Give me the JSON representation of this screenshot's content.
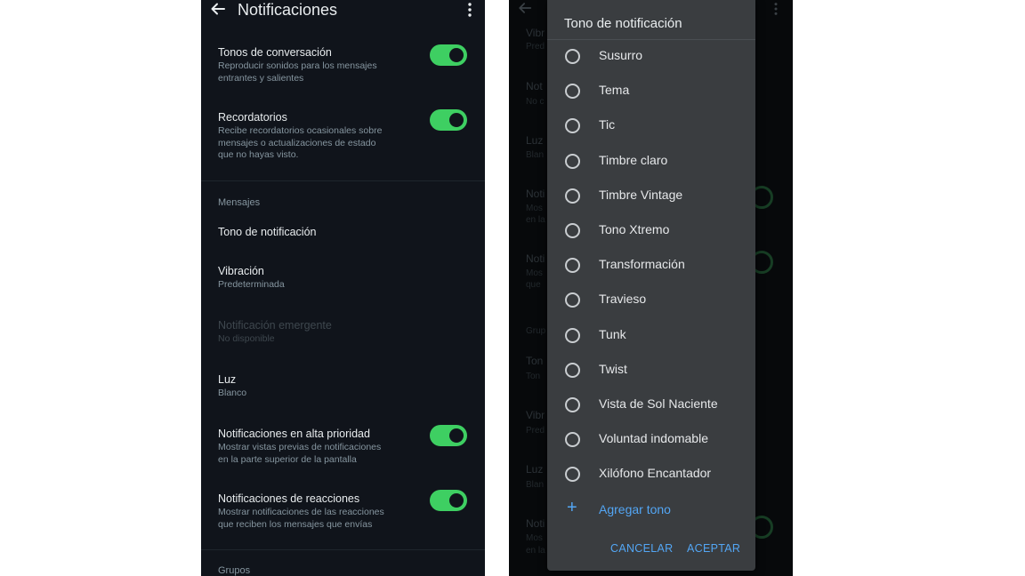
{
  "left": {
    "header": {
      "title": "Notificaciones"
    },
    "conversation_tones": {
      "title": "Tonos de conversación",
      "subtitle": "Reproducir sonidos para los mensajes\nentrantes y salientes",
      "enabled": true
    },
    "reminders": {
      "title": "Recordatorios",
      "subtitle": "Recibe recordatorios ocasionales sobre\nmensajes o actualizaciones de estado\nque no hayas visto.",
      "enabled": true
    },
    "messages_section": "Mensajes",
    "notification_tone": {
      "title": "Tono de notificación"
    },
    "vibration": {
      "title": "Vibración",
      "subtitle": "Predeterminada"
    },
    "popup": {
      "title": "Notificación emergente",
      "subtitle": "No disponible"
    },
    "light": {
      "title": "Luz",
      "subtitle": "Blanco"
    },
    "high_priority": {
      "title": "Notificaciones en alta prioridad",
      "subtitle": "Mostrar vistas previas de notificaciones\nen la parte superior de la pantalla",
      "enabled": true
    },
    "reactions": {
      "title": "Notificaciones de reacciones",
      "subtitle": "Mostrar notificaciones de las reacciones\nque reciben los mensajes que envías",
      "enabled": true
    },
    "groups_section": "Grupos"
  },
  "right": {
    "background_fragments": [
      "Vibr",
      "Pred",
      "Not",
      "No c",
      "Luz",
      "Blan",
      "Noti",
      "Mos",
      "en la",
      "Noti",
      "Mos",
      "que",
      "Grup",
      "Ton",
      "Ton",
      "Vibr",
      "Pred",
      "Luz",
      "Blan",
      "Noti",
      "Mos",
      "en la"
    ],
    "dialog": {
      "title": "Tono de notificación",
      "options": [
        "Susurro",
        "Tema",
        "Tic",
        "Timbre claro",
        "Timbre Vintage",
        "Tono Xtremo",
        "Transformación",
        "Travieso",
        "Tunk",
        "Twist",
        "Vista de Sol Naciente",
        "Voluntad indomable",
        "Xilófono Encantador"
      ],
      "add_tone": "Agregar tono",
      "cancel": "CANCELAR",
      "accept": "ACEPTAR"
    }
  },
  "colors": {
    "toggle_on": "#3ecf62",
    "accent_link": "#53a6f4",
    "left_background": "#10141b",
    "dialog_background": "#3a3d40"
  },
  "icons": {
    "back": "arrow-left-icon",
    "menu": "more-vertical-icon",
    "add": "plus-icon"
  }
}
